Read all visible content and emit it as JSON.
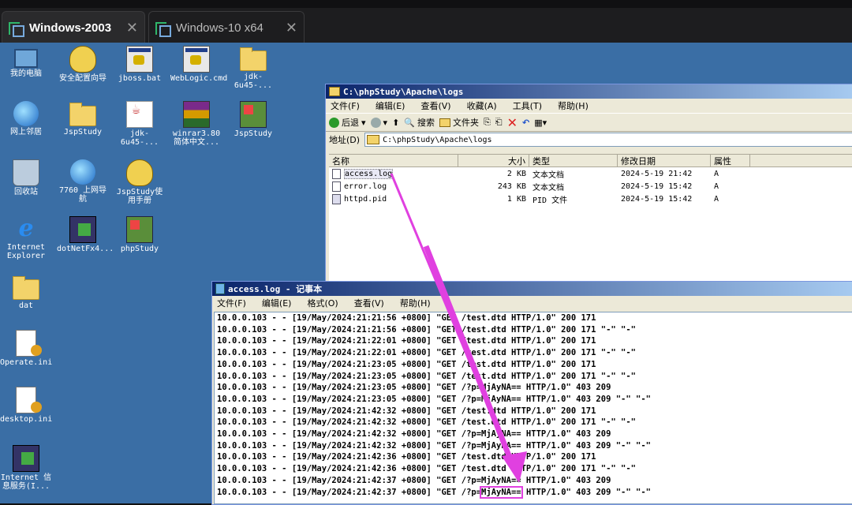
{
  "host": {
    "tabs": [
      {
        "label": "Windows-2003",
        "active": true
      },
      {
        "label": "Windows-10 x64",
        "active": false
      }
    ],
    "close_glyph": "✕"
  },
  "desktop": {
    "icons": [
      {
        "label": "我的电脑",
        "icon": "computer-icon"
      },
      {
        "label": "安全配置向导",
        "icon": "shortcut-icon"
      },
      {
        "label": "jboss.bat",
        "icon": "batch-file-icon"
      },
      {
        "label": "WebLogic.cmd",
        "icon": "batch-file-icon"
      },
      {
        "label": "jdk-6u45-...",
        "icon": "folder-icon"
      },
      {
        "label": "网上邻居",
        "icon": "network-icon"
      },
      {
        "label": "JspStudy",
        "icon": "folder-icon"
      },
      {
        "label": "jdk-6u45-...",
        "icon": "java-icon"
      },
      {
        "label": "winrar3.80 简体中文...",
        "icon": "winrar-icon"
      },
      {
        "label": "JspStudy",
        "icon": "app-shortcut-icon"
      },
      {
        "label": "回收站",
        "icon": "recycle-bin-icon"
      },
      {
        "label": "7760 上网导航",
        "icon": "ie-shortcut-icon"
      },
      {
        "label": "JspStudy使用手册",
        "icon": "shortcut-icon"
      },
      {
        "label": "Internet Explorer",
        "icon": "ie-icon"
      },
      {
        "label": "dotNetFx4...",
        "icon": "dotnet-icon"
      },
      {
        "label": "phpStudy",
        "icon": "app-shortcut-icon"
      },
      {
        "label": "dat",
        "icon": "folder-icon"
      },
      {
        "label": "Operate.ini",
        "icon": "ini-file-icon"
      },
      {
        "label": "desktop.ini",
        "icon": "ini-file-icon"
      },
      {
        "label": "Internet 信息服务(I...",
        "icon": "iis-icon"
      }
    ]
  },
  "explorer": {
    "title": "C:\\phpStudy\\Apache\\logs",
    "menu": [
      "文件(F)",
      "编辑(E)",
      "查看(V)",
      "收藏(A)",
      "工具(T)",
      "帮助(H)"
    ],
    "toolbar": {
      "back": "后退",
      "search": "搜索",
      "folders": "文件夹"
    },
    "address_label": "地址(D)",
    "address_value": "C:\\phpStudy\\Apache\\logs",
    "columns": [
      "名称",
      "大小",
      "类型",
      "修改日期",
      "属性"
    ],
    "files": [
      {
        "name": "access.log",
        "size": "2 KB",
        "type": "文本文档",
        "date": "2024-5-19 21:42",
        "attr": "A"
      },
      {
        "name": "error.log",
        "size": "243 KB",
        "type": "文本文档",
        "date": "2024-5-19 15:42",
        "attr": "A"
      },
      {
        "name": "httpd.pid",
        "size": "1 KB",
        "type": "PID 文件",
        "date": "2024-5-19 15:42",
        "attr": "A"
      }
    ]
  },
  "notepad": {
    "title": "access.log - 记事本",
    "menu": [
      "文件(F)",
      "编辑(E)",
      "格式(O)",
      "查看(V)",
      "帮助(H)"
    ],
    "lines": [
      "10.0.0.103 - - [19/May/2024:21:21:56 +0800] \"GET /test.dtd HTTP/1.0\" 200 171",
      "10.0.0.103 - - [19/May/2024:21:21:56 +0800] \"GET /test.dtd HTTP/1.0\" 200 171 \"-\" \"-\"",
      "10.0.0.103 - - [19/May/2024:21:22:01 +0800] \"GET /test.dtd HTTP/1.0\" 200 171",
      "10.0.0.103 - - [19/May/2024:21:22:01 +0800] \"GET /test.dtd HTTP/1.0\" 200 171 \"-\" \"-\"",
      "10.0.0.103 - - [19/May/2024:21:23:05 +0800] \"GET /test.dtd HTTP/1.0\" 200 171",
      "10.0.0.103 - - [19/May/2024:21:23:05 +0800] \"GET /test.dtd HTTP/1.0\" 200 171 \"-\" \"-\"",
      "10.0.0.103 - - [19/May/2024:21:23:05 +0800] \"GET /?p=MjAyNA== HTTP/1.0\" 403 209",
      "10.0.0.103 - - [19/May/2024:21:23:05 +0800] \"GET /?p=MjAyNA== HTTP/1.0\" 403 209 \"-\" \"-\"",
      "10.0.0.103 - - [19/May/2024:21:42:32 +0800] \"GET /test.dtd HTTP/1.0\" 200 171",
      "10.0.0.103 - - [19/May/2024:21:42:32 +0800] \"GET /test.dtd HTTP/1.0\" 200 171 \"-\" \"-\"",
      "10.0.0.103 - - [19/May/2024:21:42:32 +0800] \"GET /?p=MjAyNA== HTTP/1.0\" 403 209",
      "10.0.0.103 - - [19/May/2024:21:42:32 +0800] \"GET /?p=MjAyNA== HTTP/1.0\" 403 209 \"-\" \"-\"",
      "10.0.0.103 - - [19/May/2024:21:42:36 +0800] \"GET /test.dtd HTTP/1.0\" 200 171",
      "10.0.0.103 - - [19/May/2024:21:42:36 +0800] \"GET /test.dtd HTTP/1.0\" 200 171 \"-\" \"-\"",
      "10.0.0.103 - - [19/May/2024:21:42:37 +0800] \"GET /?p=MjAyNA== HTTP/1.0\" 403 209"
    ],
    "last_line": {
      "before": "10.0.0.103 - - [19/May/2024:21:42:37 +0800] \"GET /?p=",
      "highlight": "MjAyNA==",
      "after": " HTTP/1.0\" 403 209 \"-\" \"-\""
    }
  },
  "colors": {
    "annotation": "#e040e0",
    "desktop": "#3a6ea5"
  }
}
